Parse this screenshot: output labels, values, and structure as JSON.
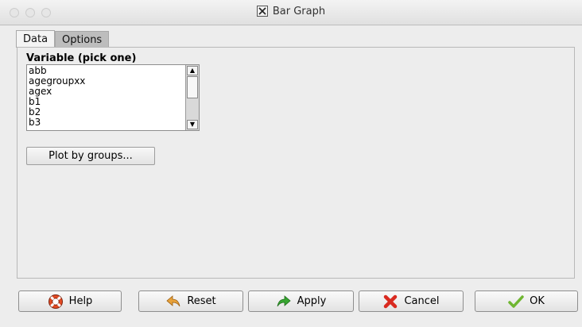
{
  "window": {
    "title": "Bar Graph"
  },
  "tabs": [
    {
      "label": "Data",
      "active": true
    },
    {
      "label": "Options",
      "active": false
    }
  ],
  "data_tab": {
    "variable_label": "Variable (pick one)",
    "variables": [
      "abb",
      "agegroupxx",
      "agex",
      "b1",
      "b2",
      "b3"
    ],
    "plot_by_groups_label": "Plot by groups..."
  },
  "buttons": {
    "help": {
      "label": "Help",
      "icon": "lifebuoy-icon"
    },
    "reset": {
      "label": "Reset",
      "icon": "back-arrow-icon"
    },
    "apply": {
      "label": "Apply",
      "icon": "forward-arrow-icon"
    },
    "cancel": {
      "label": "Cancel",
      "icon": "red-x-icon"
    },
    "ok": {
      "label": "OK",
      "icon": "checkmark-icon"
    }
  },
  "colors": {
    "window_bg": "#ededed",
    "apply_icon": "#37a631",
    "reset_icon": "#e8a23a",
    "cancel_icon": "#d92a20",
    "ok_icon": "#6fb631",
    "help_icon": "#e24a23"
  }
}
